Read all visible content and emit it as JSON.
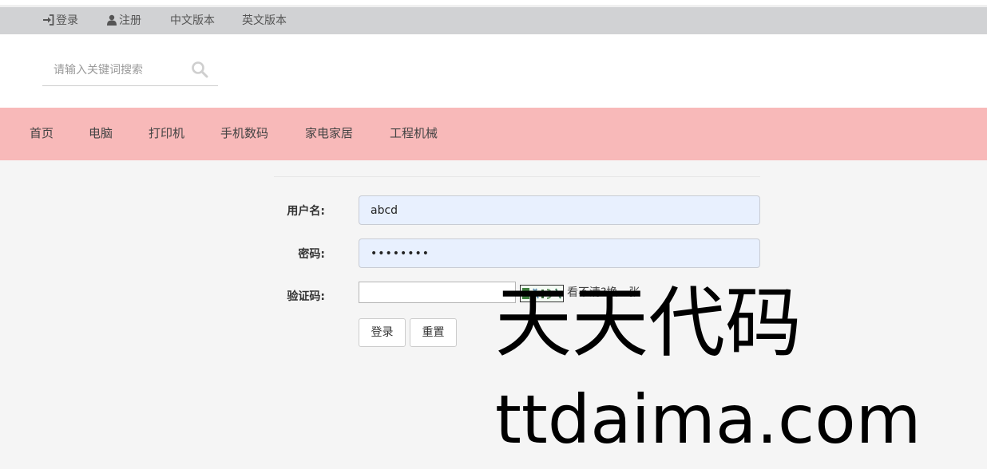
{
  "topbar": {
    "login_label": "登录",
    "register_label": "注册",
    "chinese_label": "中文版本",
    "english_label": "英文版本"
  },
  "search": {
    "placeholder": "请输入关键词搜索"
  },
  "nav": {
    "items": [
      "首页",
      "电脑",
      "打印机",
      "手机数码",
      "家电家居",
      "工程机械"
    ]
  },
  "form": {
    "username_label": "用户名:",
    "username_value": "abcd",
    "password_label": "密码:",
    "password_value": "••••••••",
    "captcha_label": "验证码:",
    "captcha_value": "",
    "captcha_refresh": "看不清?换一张",
    "login_button": "登录",
    "reset_button": "重置"
  },
  "watermark": {
    "line1": "天天代码",
    "line2": "ttdaima.com"
  }
}
